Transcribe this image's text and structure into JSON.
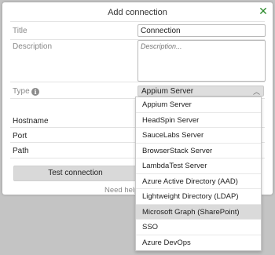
{
  "dialog": {
    "title": "Add connection",
    "close_icon": "close-icon"
  },
  "form": {
    "title_label": "Title",
    "title_value": "Connection",
    "description_label": "Description",
    "description_placeholder": "Description...",
    "type_label": "Type",
    "type_info_icon": "info-icon",
    "type_selected": "Appium Server",
    "hostname_label": "Hostname",
    "port_label": "Port",
    "path_label": "Path"
  },
  "actions": {
    "test_label": "Test connection",
    "help_label": "Need help?"
  },
  "dropdown": {
    "selected_index": 7,
    "options": [
      "Appium Server",
      "HeadSpin Server",
      "SauceLabs Server",
      "BrowserStack Server",
      "LambdaTest Server",
      "Azure Active Directory (AAD)",
      "Lightweight Directory (LDAP)",
      "Microsoft Graph (SharePoint)",
      "SSO",
      "Azure DevOps"
    ]
  },
  "colors": {
    "overlay": "#c4c4c4",
    "close_accent": "#2e8b2e",
    "highlight": "#dadada"
  }
}
